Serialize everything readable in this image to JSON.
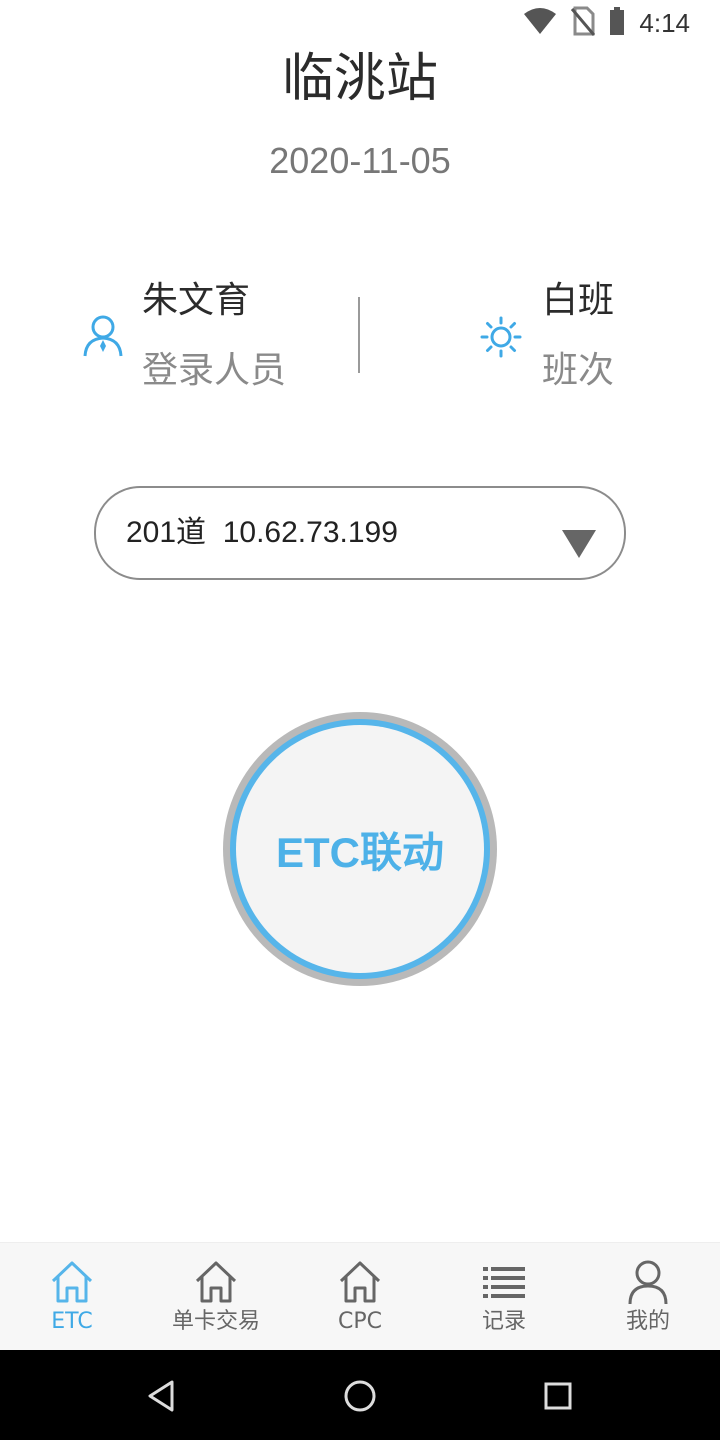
{
  "status_bar": {
    "time": "4:14"
  },
  "header": {
    "station": "临洮站",
    "date": "2020-11-05"
  },
  "info": {
    "user_name": "朱文育",
    "user_caption": "登录人员",
    "shift_name": "白班",
    "shift_caption": "班次"
  },
  "lane_select": {
    "value": "201道  10.62.73.199"
  },
  "main_button": {
    "label": "ETC联动"
  },
  "bottom_nav": {
    "items": [
      {
        "label": "ETC",
        "icon": "home-icon",
        "active": true
      },
      {
        "label": "单卡交易",
        "icon": "home-icon",
        "active": false
      },
      {
        "label": "CPC",
        "icon": "home-icon",
        "active": false
      },
      {
        "label": "记录",
        "icon": "list-icon",
        "active": false
      },
      {
        "label": "我的",
        "icon": "person-icon",
        "active": false
      }
    ]
  },
  "colors": {
    "accent": "#56b5ea",
    "text_dark": "#2b2b2b",
    "text_muted": "#8a8a8a"
  }
}
